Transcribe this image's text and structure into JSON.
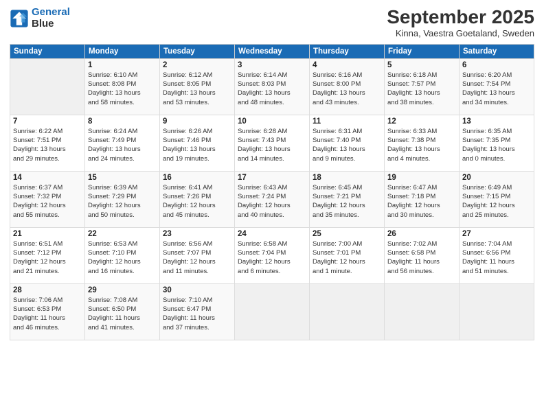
{
  "header": {
    "logo_line1": "General",
    "logo_line2": "Blue",
    "month_title": "September 2025",
    "subtitle": "Kinna, Vaestra Goetaland, Sweden"
  },
  "days_of_week": [
    "Sunday",
    "Monday",
    "Tuesday",
    "Wednesday",
    "Thursday",
    "Friday",
    "Saturday"
  ],
  "weeks": [
    [
      {
        "day": "",
        "detail": ""
      },
      {
        "day": "1",
        "detail": "Sunrise: 6:10 AM\nSunset: 8:08 PM\nDaylight: 13 hours\nand 58 minutes."
      },
      {
        "day": "2",
        "detail": "Sunrise: 6:12 AM\nSunset: 8:05 PM\nDaylight: 13 hours\nand 53 minutes."
      },
      {
        "day": "3",
        "detail": "Sunrise: 6:14 AM\nSunset: 8:03 PM\nDaylight: 13 hours\nand 48 minutes."
      },
      {
        "day": "4",
        "detail": "Sunrise: 6:16 AM\nSunset: 8:00 PM\nDaylight: 13 hours\nand 43 minutes."
      },
      {
        "day": "5",
        "detail": "Sunrise: 6:18 AM\nSunset: 7:57 PM\nDaylight: 13 hours\nand 38 minutes."
      },
      {
        "day": "6",
        "detail": "Sunrise: 6:20 AM\nSunset: 7:54 PM\nDaylight: 13 hours\nand 34 minutes."
      }
    ],
    [
      {
        "day": "7",
        "detail": "Sunrise: 6:22 AM\nSunset: 7:51 PM\nDaylight: 13 hours\nand 29 minutes."
      },
      {
        "day": "8",
        "detail": "Sunrise: 6:24 AM\nSunset: 7:49 PM\nDaylight: 13 hours\nand 24 minutes."
      },
      {
        "day": "9",
        "detail": "Sunrise: 6:26 AM\nSunset: 7:46 PM\nDaylight: 13 hours\nand 19 minutes."
      },
      {
        "day": "10",
        "detail": "Sunrise: 6:28 AM\nSunset: 7:43 PM\nDaylight: 13 hours\nand 14 minutes."
      },
      {
        "day": "11",
        "detail": "Sunrise: 6:31 AM\nSunset: 7:40 PM\nDaylight: 13 hours\nand 9 minutes."
      },
      {
        "day": "12",
        "detail": "Sunrise: 6:33 AM\nSunset: 7:38 PM\nDaylight: 13 hours\nand 4 minutes."
      },
      {
        "day": "13",
        "detail": "Sunrise: 6:35 AM\nSunset: 7:35 PM\nDaylight: 13 hours\nand 0 minutes."
      }
    ],
    [
      {
        "day": "14",
        "detail": "Sunrise: 6:37 AM\nSunset: 7:32 PM\nDaylight: 12 hours\nand 55 minutes."
      },
      {
        "day": "15",
        "detail": "Sunrise: 6:39 AM\nSunset: 7:29 PM\nDaylight: 12 hours\nand 50 minutes."
      },
      {
        "day": "16",
        "detail": "Sunrise: 6:41 AM\nSunset: 7:26 PM\nDaylight: 12 hours\nand 45 minutes."
      },
      {
        "day": "17",
        "detail": "Sunrise: 6:43 AM\nSunset: 7:24 PM\nDaylight: 12 hours\nand 40 minutes."
      },
      {
        "day": "18",
        "detail": "Sunrise: 6:45 AM\nSunset: 7:21 PM\nDaylight: 12 hours\nand 35 minutes."
      },
      {
        "day": "19",
        "detail": "Sunrise: 6:47 AM\nSunset: 7:18 PM\nDaylight: 12 hours\nand 30 minutes."
      },
      {
        "day": "20",
        "detail": "Sunrise: 6:49 AM\nSunset: 7:15 PM\nDaylight: 12 hours\nand 25 minutes."
      }
    ],
    [
      {
        "day": "21",
        "detail": "Sunrise: 6:51 AM\nSunset: 7:12 PM\nDaylight: 12 hours\nand 21 minutes."
      },
      {
        "day": "22",
        "detail": "Sunrise: 6:53 AM\nSunset: 7:10 PM\nDaylight: 12 hours\nand 16 minutes."
      },
      {
        "day": "23",
        "detail": "Sunrise: 6:56 AM\nSunset: 7:07 PM\nDaylight: 12 hours\nand 11 minutes."
      },
      {
        "day": "24",
        "detail": "Sunrise: 6:58 AM\nSunset: 7:04 PM\nDaylight: 12 hours\nand 6 minutes."
      },
      {
        "day": "25",
        "detail": "Sunrise: 7:00 AM\nSunset: 7:01 PM\nDaylight: 12 hours\nand 1 minute."
      },
      {
        "day": "26",
        "detail": "Sunrise: 7:02 AM\nSunset: 6:58 PM\nDaylight: 11 hours\nand 56 minutes."
      },
      {
        "day": "27",
        "detail": "Sunrise: 7:04 AM\nSunset: 6:56 PM\nDaylight: 11 hours\nand 51 minutes."
      }
    ],
    [
      {
        "day": "28",
        "detail": "Sunrise: 7:06 AM\nSunset: 6:53 PM\nDaylight: 11 hours\nand 46 minutes."
      },
      {
        "day": "29",
        "detail": "Sunrise: 7:08 AM\nSunset: 6:50 PM\nDaylight: 11 hours\nand 41 minutes."
      },
      {
        "day": "30",
        "detail": "Sunrise: 7:10 AM\nSunset: 6:47 PM\nDaylight: 11 hours\nand 37 minutes."
      },
      {
        "day": "",
        "detail": ""
      },
      {
        "day": "",
        "detail": ""
      },
      {
        "day": "",
        "detail": ""
      },
      {
        "day": "",
        "detail": ""
      }
    ]
  ]
}
